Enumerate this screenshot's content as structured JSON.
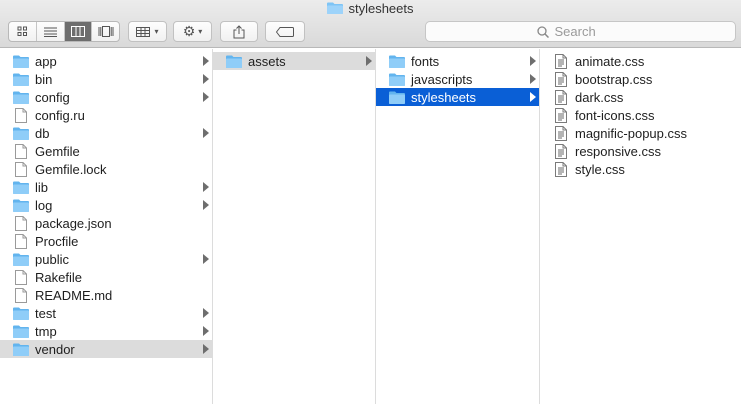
{
  "window": {
    "title": "stylesheets"
  },
  "toolbar": {
    "view_modes": [
      "icon-view",
      "list-view",
      "column-view",
      "coverflow-view"
    ],
    "active_view": 2
  },
  "search": {
    "placeholder": "Search"
  },
  "colors": {
    "selection": "#0a5fd6",
    "highlight": "#dcdcdc",
    "folder": "#7ec4f5"
  },
  "columns": [
    {
      "items": [
        {
          "label": "app",
          "kind": "folder"
        },
        {
          "label": "bin",
          "kind": "folder"
        },
        {
          "label": "config",
          "kind": "folder"
        },
        {
          "label": "config.ru",
          "kind": "file"
        },
        {
          "label": "db",
          "kind": "folder"
        },
        {
          "label": "Gemfile",
          "kind": "file"
        },
        {
          "label": "Gemfile.lock",
          "kind": "file"
        },
        {
          "label": "lib",
          "kind": "folder"
        },
        {
          "label": "log",
          "kind": "folder"
        },
        {
          "label": "package.json",
          "kind": "file"
        },
        {
          "label": "Procfile",
          "kind": "file"
        },
        {
          "label": "public",
          "kind": "folder"
        },
        {
          "label": "Rakefile",
          "kind": "file"
        },
        {
          "label": "README.md",
          "kind": "file"
        },
        {
          "label": "test",
          "kind": "folder"
        },
        {
          "label": "tmp",
          "kind": "folder"
        },
        {
          "label": "vendor",
          "kind": "folder",
          "state": "highlighted"
        }
      ]
    },
    {
      "items": [
        {
          "label": "assets",
          "kind": "folder",
          "state": "highlighted"
        }
      ]
    },
    {
      "items": [
        {
          "label": "fonts",
          "kind": "folder"
        },
        {
          "label": "javascripts",
          "kind": "folder"
        },
        {
          "label": "stylesheets",
          "kind": "folder",
          "state": "selected"
        }
      ]
    },
    {
      "items": [
        {
          "label": "animate.css",
          "kind": "css"
        },
        {
          "label": "bootstrap.css",
          "kind": "css"
        },
        {
          "label": "dark.css",
          "kind": "css"
        },
        {
          "label": "font-icons.css",
          "kind": "css"
        },
        {
          "label": "magnific-popup.css",
          "kind": "css"
        },
        {
          "label": "responsive.css",
          "kind": "css"
        },
        {
          "label": "style.css",
          "kind": "css"
        }
      ]
    }
  ]
}
